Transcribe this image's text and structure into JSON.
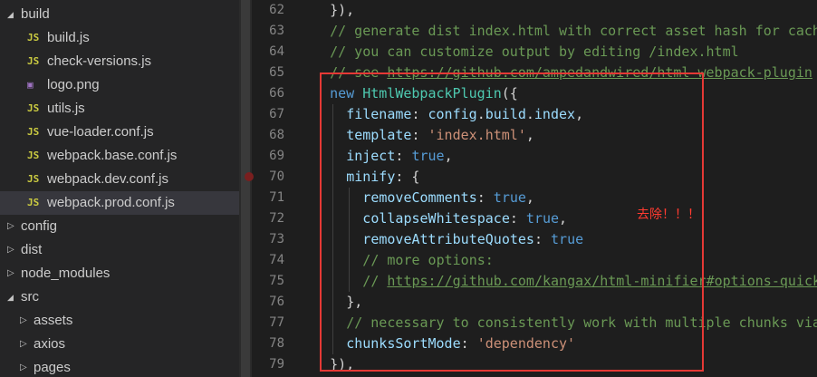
{
  "explorer": {
    "items": [
      {
        "label": "build",
        "kind": "folder-open",
        "depth": 0
      },
      {
        "label": "build.js",
        "kind": "js",
        "depth": 1
      },
      {
        "label": "check-versions.js",
        "kind": "js",
        "depth": 1
      },
      {
        "label": "logo.png",
        "kind": "image",
        "depth": 1
      },
      {
        "label": "utils.js",
        "kind": "js",
        "depth": 1
      },
      {
        "label": "vue-loader.conf.js",
        "kind": "js",
        "depth": 1
      },
      {
        "label": "webpack.base.conf.js",
        "kind": "js",
        "depth": 1
      },
      {
        "label": "webpack.dev.conf.js",
        "kind": "js",
        "depth": 1
      },
      {
        "label": "webpack.prod.conf.js",
        "kind": "js",
        "depth": 1,
        "selected": true
      },
      {
        "label": "config",
        "kind": "folder",
        "depth": 0
      },
      {
        "label": "dist",
        "kind": "folder",
        "depth": 0
      },
      {
        "label": "node_modules",
        "kind": "folder",
        "depth": 0
      },
      {
        "label": "src",
        "kind": "folder-open",
        "depth": 0
      },
      {
        "label": "assets",
        "kind": "folder",
        "depth": 1
      },
      {
        "label": "axios",
        "kind": "folder",
        "depth": 1
      },
      {
        "label": "pages",
        "kind": "folder",
        "depth": 1
      }
    ]
  },
  "icons": {
    "folder_open": "chevron-down-icon",
    "folder_closed": "chevron-right-icon",
    "js": "js-file-icon",
    "image": "image-file-icon"
  },
  "editor": {
    "breakpoint_line": 70,
    "lines": [
      {
        "n": "62",
        "indent": 2,
        "tokens": [
          {
            "t": "p",
            "v": "}),"
          }
        ]
      },
      {
        "n": "63",
        "indent": 2,
        "tokens": [
          {
            "t": "cm",
            "v": "// generate dist index.html with correct asset hash for caching."
          }
        ]
      },
      {
        "n": "64",
        "indent": 2,
        "tokens": [
          {
            "t": "cm",
            "v": "// you can customize output by editing /index.html"
          }
        ]
      },
      {
        "n": "65",
        "indent": 2,
        "tokens": [
          {
            "t": "cm",
            "v": "// see "
          },
          {
            "t": "link",
            "v": "https://github.com/ampedandwired/html-webpack-plugin"
          }
        ]
      },
      {
        "n": "66",
        "indent": 2,
        "tokens": [
          {
            "t": "kw",
            "v": "new "
          },
          {
            "t": "cls",
            "v": "HtmlWebpackPlugin"
          },
          {
            "t": "p",
            "v": "({"
          }
        ]
      },
      {
        "n": "67",
        "indent": 4,
        "tokens": [
          {
            "t": "prop",
            "v": "filename"
          },
          {
            "t": "p",
            "v": ": "
          },
          {
            "t": "prop",
            "v": "config"
          },
          {
            "t": "p",
            "v": "."
          },
          {
            "t": "prop",
            "v": "build"
          },
          {
            "t": "p",
            "v": "."
          },
          {
            "t": "prop",
            "v": "index"
          },
          {
            "t": "p",
            "v": ","
          }
        ]
      },
      {
        "n": "68",
        "indent": 4,
        "tokens": [
          {
            "t": "prop",
            "v": "template"
          },
          {
            "t": "p",
            "v": ": "
          },
          {
            "t": "str",
            "v": "'index.html'"
          },
          {
            "t": "p",
            "v": ","
          }
        ]
      },
      {
        "n": "69",
        "indent": 4,
        "tokens": [
          {
            "t": "prop",
            "v": "inject"
          },
          {
            "t": "p",
            "v": ": "
          },
          {
            "t": "kw",
            "v": "true"
          },
          {
            "t": "p",
            "v": ","
          }
        ]
      },
      {
        "n": "70",
        "indent": 4,
        "tokens": [
          {
            "t": "prop",
            "v": "minify"
          },
          {
            "t": "p",
            "v": ": {"
          }
        ]
      },
      {
        "n": "71",
        "indent": 6,
        "tokens": [
          {
            "t": "prop",
            "v": "removeComments"
          },
          {
            "t": "p",
            "v": ": "
          },
          {
            "t": "kw",
            "v": "true"
          },
          {
            "t": "p",
            "v": ","
          }
        ]
      },
      {
        "n": "72",
        "indent": 6,
        "tokens": [
          {
            "t": "prop",
            "v": "collapseWhitespace"
          },
          {
            "t": "p",
            "v": ": "
          },
          {
            "t": "kw",
            "v": "true"
          },
          {
            "t": "p",
            "v": ","
          }
        ]
      },
      {
        "n": "73",
        "indent": 6,
        "tokens": [
          {
            "t": "prop",
            "v": "removeAttributeQuotes"
          },
          {
            "t": "p",
            "v": ": "
          },
          {
            "t": "kw",
            "v": "true"
          }
        ]
      },
      {
        "n": "74",
        "indent": 6,
        "tokens": [
          {
            "t": "cm",
            "v": "// more options:"
          }
        ]
      },
      {
        "n": "75",
        "indent": 6,
        "tokens": [
          {
            "t": "cm",
            "v": "// "
          },
          {
            "t": "link",
            "v": "https://github.com/kangax/html-minifier#options-quick-reference"
          }
        ]
      },
      {
        "n": "76",
        "indent": 4,
        "tokens": [
          {
            "t": "p",
            "v": "},"
          }
        ]
      },
      {
        "n": "77",
        "indent": 4,
        "tokens": [
          {
            "t": "cm",
            "v": "// necessary to consistently work with multiple chunks via CommonsChunkPlugin"
          }
        ]
      },
      {
        "n": "78",
        "indent": 4,
        "tokens": [
          {
            "t": "prop",
            "v": "chunksSortMode"
          },
          {
            "t": "p",
            "v": ": "
          },
          {
            "t": "str",
            "v": "'dependency'"
          }
        ]
      },
      {
        "n": "79",
        "indent": 2,
        "tokens": [
          {
            "t": "p",
            "v": "}),"
          }
        ]
      }
    ]
  },
  "annotation": {
    "text": "去除！！！",
    "color": "#ff3b30"
  },
  "colors": {
    "highlight_box": "#e53935",
    "sidebar_bg": "#252526",
    "editor_bg": "#1e1e1e",
    "selected_row": "#37373d"
  }
}
